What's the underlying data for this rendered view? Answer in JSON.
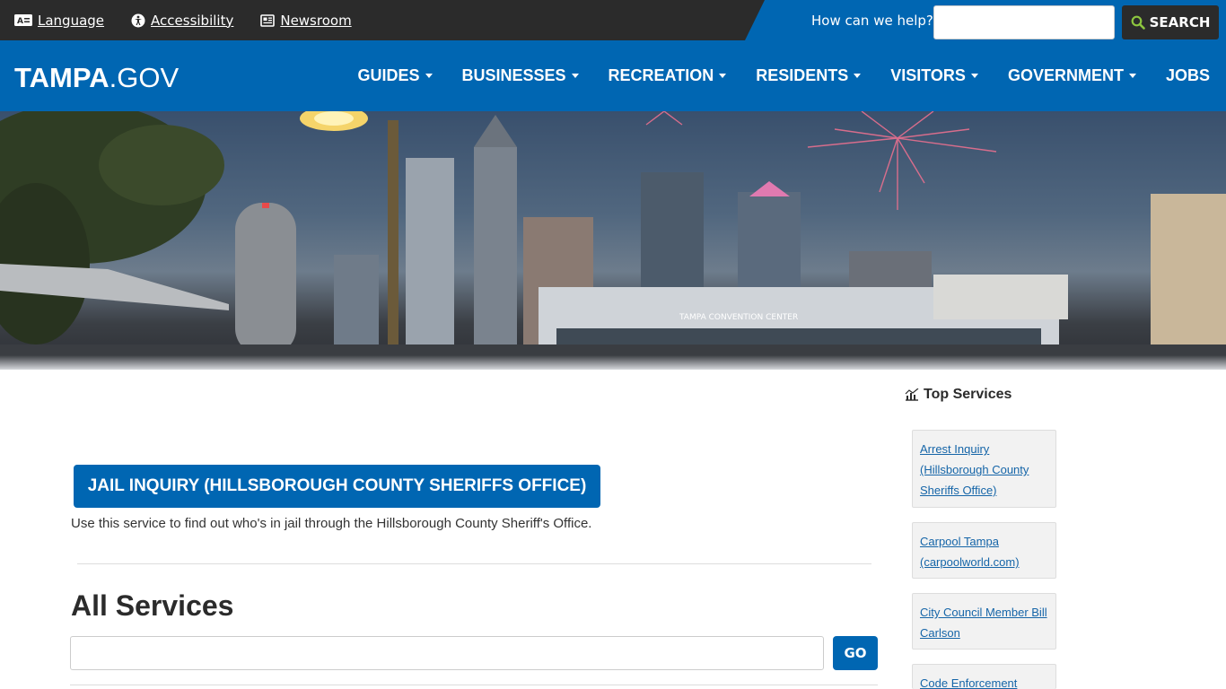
{
  "utility": {
    "links": [
      {
        "label": "Language",
        "icon": "language-icon"
      },
      {
        "label": "Accessibility",
        "icon": "accessibility-icon"
      },
      {
        "label": "Newsroom",
        "icon": "newsroom-icon"
      }
    ],
    "help_label": "How can we help?",
    "search_placeholder": "",
    "search_button": "SEARCH"
  },
  "nav": {
    "logo_bold": "TAMPA",
    "logo_light": ".GOV",
    "items": [
      {
        "label": "GUIDES"
      },
      {
        "label": "BUSINESSES"
      },
      {
        "label": "RECREATION"
      },
      {
        "label": "RESIDENTS"
      },
      {
        "label": "VISITORS"
      },
      {
        "label": "GOVERNMENT"
      },
      {
        "label": "JOBS"
      }
    ]
  },
  "hero": {
    "building_sign": "TAMPA CONVENTION CENTER"
  },
  "content": {
    "jail_button": "JAIL INQUIRY (HILLSBOROUGH COUNTY SHERIFFS OFFICE)",
    "jail_description": "Use this service to find out who's in jail through the Hillsborough County Sheriff's Office.",
    "all_services_title": "All Services",
    "all_services_placeholder": "",
    "go_button": "GO"
  },
  "sidebar": {
    "title": "Top Services",
    "services": [
      {
        "line1": "Arrest Inquiry",
        "line2": "(Hillsborough County",
        "line3": "Sheriffs Office)"
      },
      {
        "line1": "Carpool Tampa",
        "line2": "(carpoolworld.com)"
      },
      {
        "line1": "City Council Member Bill",
        "line2": "Carlson"
      },
      {
        "line1": "Code Enforcement Board"
      }
    ]
  },
  "colors": {
    "brand_blue": "#0066b2",
    "dark_bar": "#2b2b2b",
    "link_blue": "#1565a8"
  }
}
